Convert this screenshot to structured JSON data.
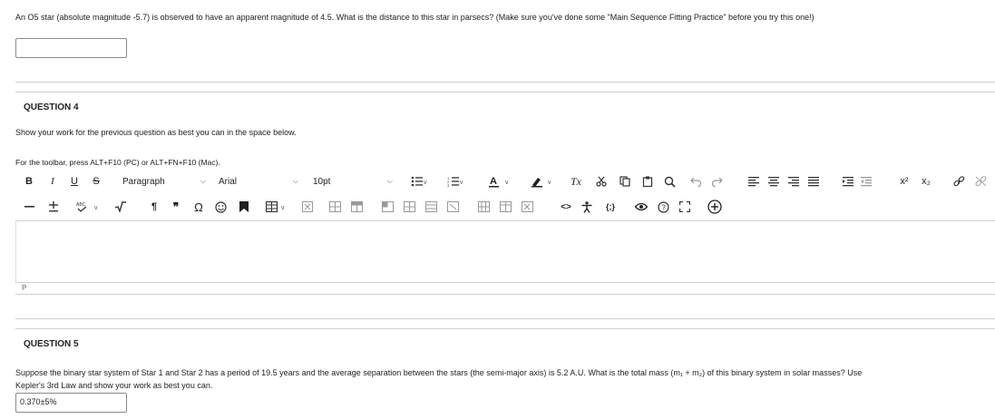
{
  "question3": {
    "text": "An O5 star (absolute magnitude -5.7) is observed to have an apparent magnitude of 4.5. What is the distance to this star in parsecs? (Make sure you've done some \"Main Sequence Fitting Practice\" before you try this one!)",
    "answer_value": ""
  },
  "question4": {
    "heading": "QUESTION 4",
    "prompt": "Show your work for the previous question as best you can in the space below.",
    "toolbar_hint": "For the toolbar, press ALT+F10 (PC) or ALT+FN+F10 (Mac).",
    "toolbar": {
      "bold": "B",
      "italic": "I",
      "underline": "U",
      "strike": "S",
      "paragraph_format": "Paragraph",
      "font_family": "Arial",
      "font_size": "10pt",
      "clear_format": "Tx",
      "superscript": "x²",
      "subscript": "x₂",
      "pilcrow": "¶",
      "quote": "❞",
      "omega": "Ω",
      "code": "<>",
      "braces": "{;}"
    },
    "status_path": "P"
  },
  "question5": {
    "heading": "QUESTION 5",
    "text": "Suppose the binary star system of Star 1 and Star 2 has a period of 19.5 years and the average separation between the stars (the semi-major axis) is 5.2 A.U. What is the total mass (m₁ + m₂) of this binary system in solar masses? Use Kepler's 3rd Law and show your work as best you can.",
    "answer_value": "0.370±5%"
  },
  "colors": {
    "separator": "#cfcfcf",
    "text": "#222222",
    "field_border": "#8a8a8a"
  }
}
